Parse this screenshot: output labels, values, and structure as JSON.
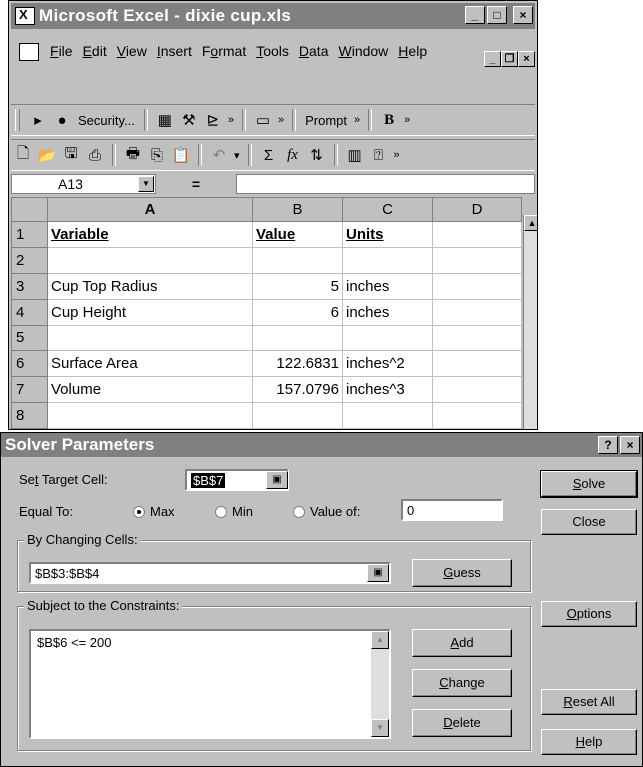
{
  "excel": {
    "title": "Microsoft Excel - dixie cup.xls",
    "window_buttons": [
      "_",
      "□",
      "×"
    ],
    "menu": [
      "File",
      "Edit",
      "View",
      "Insert",
      "Format",
      "Tools",
      "Data",
      "Window",
      "Help"
    ],
    "menu_mnemonics": [
      "F",
      "E",
      "V",
      "I",
      "o",
      "T",
      "D",
      "W",
      "H"
    ],
    "toolbar1": {
      "security_label": "Security...",
      "prompt_label": "Prompt",
      "bold_label": "B"
    },
    "name_box": "A13",
    "formula_eq": "=",
    "columns": [
      "A",
      "B",
      "C",
      "D"
    ],
    "rows": [
      {
        "n": "1",
        "a": "Variable",
        "b": "Value",
        "c": "Units",
        "header": true
      },
      {
        "n": "2",
        "a": "",
        "b": "",
        "c": ""
      },
      {
        "n": "3",
        "a": "Cup Top Radius",
        "b": "5",
        "c": "inches"
      },
      {
        "n": "4",
        "a": "Cup Height",
        "b": "6",
        "c": "inches"
      },
      {
        "n": "5",
        "a": "",
        "b": "",
        "c": ""
      },
      {
        "n": "6",
        "a": "Surface Area",
        "b": "122.6831",
        "c": "inches^2"
      },
      {
        "n": "7",
        "a": "Volume",
        "b": "157.0796",
        "c": "inches^3"
      },
      {
        "n": "8",
        "a": "",
        "b": "",
        "c": ""
      }
    ]
  },
  "solver": {
    "title": "Solver Parameters",
    "title_buttons": [
      "?",
      "×"
    ],
    "target_label": "Set Target Cell:",
    "target_value": "$B$7",
    "equal_to_label": "Equal To:",
    "opt_max": "Max",
    "opt_min": "Min",
    "opt_value": "Value of:",
    "value_of": "0",
    "changing_label": "By Changing Cells:",
    "changing_value": "$B$3:$B$4",
    "guess": "Guess",
    "constraints_label": "Subject to the Constraints:",
    "constraints": [
      "$B$6 <= 200"
    ],
    "add": "Add",
    "change": "Change",
    "delete": "Delete",
    "solve": "Solve",
    "close": "Close",
    "options": "Options",
    "reset_all": "Reset All",
    "help": "Help"
  }
}
